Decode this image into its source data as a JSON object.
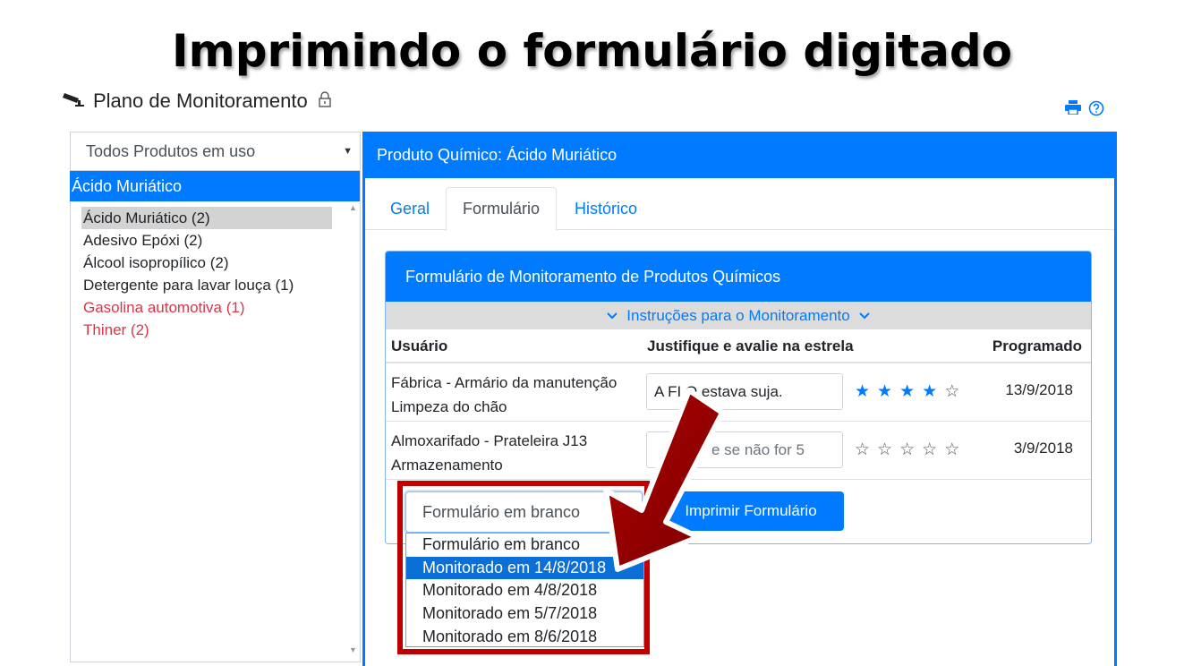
{
  "slide_title": "Imprimindo o formulário digitado",
  "header": {
    "icon": "surveillance-camera-icon",
    "title": "Plano de Monitoramento",
    "lock_icon": "lock-icon"
  },
  "tools": {
    "print_icon": "print-icon",
    "help_icon": "help-icon"
  },
  "left_panel": {
    "filter_value": "Todos Produtos em uso",
    "selected_product": "Ácido Muriático",
    "products": [
      {
        "label": "Ácido Muriático (2)",
        "status": "active"
      },
      {
        "label": "Adesivo Epóxi (2)",
        "status": "normal"
      },
      {
        "label": "Álcool isopropílico (2)",
        "status": "normal"
      },
      {
        "label": "Detergente para lavar louça (1)",
        "status": "normal"
      },
      {
        "label": "Gasolina automotiva (1)",
        "status": "warning"
      },
      {
        "label": "Thiner (2)",
        "status": "warning"
      }
    ]
  },
  "right_panel": {
    "title": "Produto Químico: Ácido Muriático",
    "tabs": [
      {
        "label": "Geral"
      },
      {
        "label": "Formulário"
      },
      {
        "label": "Histórico"
      }
    ],
    "active_tab": "Formulário",
    "form": {
      "title": "Formulário de Monitoramento de Produtos Químicos",
      "instructions": "Instruções para o Monitoramento",
      "columns": {
        "user": "Usuário",
        "justify": "Justifique e avalie na estrela",
        "scheduled": "Programado"
      },
      "rows": [
        {
          "user_line1": "Fábrica - Armário da manutenção",
          "user_line2": "Limpeza do chão",
          "justification": "A FI  O estava suja.",
          "rating": 4,
          "max_rating": 5,
          "date": "13/9/2018"
        },
        {
          "user_line1": "Almoxarifado - Prateleira J13",
          "user_line2": "Armazenamento",
          "justification_placeholder": "e se não for 5",
          "rating": 0,
          "max_rating": 5,
          "date": "3/9/2018"
        }
      ],
      "print_select_value": "Formulário em branco",
      "print_button": "Imprimir Formulário",
      "print_options": [
        "Formulário em branco",
        "Monitorado em 14/8/2018",
        "Monitorado em 4/8/2018",
        "Monitorado em 5/7/2018",
        "Monitorado em 8/6/2018"
      ],
      "highlighted_option": "Monitorado em 14/8/2018"
    }
  },
  "colors": {
    "primary": "#007bff",
    "danger": "#dc3545",
    "highlight": "#c00000",
    "selected_bg": "#d3d3d3"
  }
}
